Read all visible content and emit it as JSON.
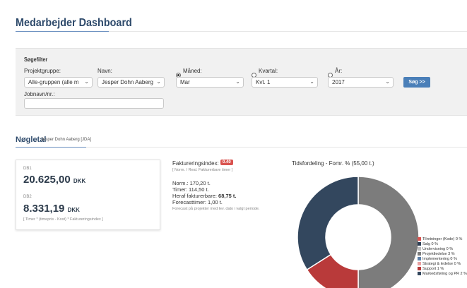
{
  "page": {
    "title": "Medarbejder Dashboard"
  },
  "filter": {
    "title": "Søgefilter",
    "project_group_label": "Projektgruppe:",
    "project_group_value": "Alle-gruppen (alle m",
    "name_label": "Navn:",
    "name_value": "Jesper Dohn Aaberg",
    "month_label": "Måned:",
    "month_value": "Mar",
    "quarter_label": "Kvartal:",
    "quarter_value": "Kvt. 1",
    "year_label": "År:",
    "year_value": "2017",
    "job_label": "Jobnavn/nr.:",
    "job_value": "",
    "search_label": "Søg >>",
    "selected_period": "month"
  },
  "keyfigures": {
    "title": "Nøgletal",
    "subtitle": "Jesper Dohn Aaberg [JDA]",
    "db1_label": "DB1",
    "db1_value": "20.625,00",
    "db1_unit": "DKK",
    "db2_label": "DB2",
    "db2_value": "8.331,19",
    "db2_unit": "DKK",
    "db2_formula": "[ Timer * (timepris - Kost) * Faktureringsindex ]"
  },
  "billing": {
    "index_label": "Faktureringsindex:",
    "index_badge": "0.40",
    "index_formula": "[ Norm. / Real. Fakturerbare timer ]",
    "norm": "Norm.: 170,20 t.",
    "hours": "Timer: 114,50 t.",
    "billable_prefix": "Heraf fakturerbare: ",
    "billable_value": "68,75 t.",
    "forecast": "Forecasttimer: 1,00 t.",
    "forecast_note": "Forecast på projekter med lev. dato i valgt periode."
  },
  "time_chart": {
    "title": "Tidsfordeling - Fomr. % (55,00 t.)",
    "colors": {
      "gray": "#7c7c7c",
      "red": "#b93a3a",
      "navy": "#33475e"
    }
  },
  "chart_data": {
    "type": "pie",
    "title": "Tidsfordeling - Fomr. % (55,00 t.)",
    "slices": [
      {
        "label": "Markedsføring og PR",
        "value": 50,
        "color": "#7c7c7c"
      },
      {
        "label": "Support",
        "value": 16,
        "color": "#b93a3a"
      },
      {
        "label": "Projektledelse",
        "value": 34,
        "color": "#33475e"
      }
    ],
    "legend": [
      {
        "label": "Tilretninger (Kode) 0 %",
        "color": "#d9534f"
      },
      {
        "label": "Salg 0 %",
        "color": "#2e3f55"
      },
      {
        "label": "Undervisning 0 %",
        "color": "#bdbdbd"
      },
      {
        "label": "Projektledelse 3 %",
        "color": "#7c7c7c"
      },
      {
        "label": "Implementering 0 %",
        "color": "#5b7fa8"
      },
      {
        "label": "Strategi & ledelse 0 %",
        "color": "#e8a0a0"
      },
      {
        "label": "Support 1 %",
        "color": "#b93a3a"
      },
      {
        "label": "Markedsføring og PR 2 %",
        "color": "#33475e"
      }
    ],
    "legend_position": "bottom-right"
  }
}
